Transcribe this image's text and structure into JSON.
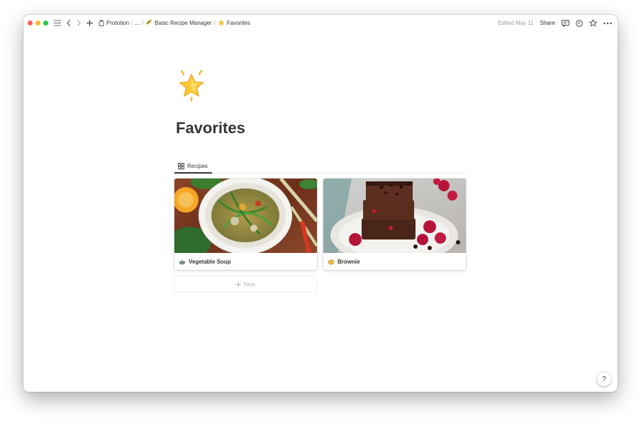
{
  "topbar": {
    "breadcrumbs": [
      {
        "label": "Prototion",
        "icon": "page-icon"
      },
      {
        "label": "...",
        "icon": ""
      },
      {
        "label": "Basic Recipe Manager",
        "icon": "taco-emoji"
      },
      {
        "label": "Favorites",
        "icon": "star-emoji"
      }
    ],
    "separator": "/",
    "edited": "Edited May 11",
    "share_label": "Share"
  },
  "page": {
    "icon": "glowing-star-emoji",
    "title": "Favorites"
  },
  "view_tab": {
    "label": "Recipes",
    "icon": "gallery-icon"
  },
  "cards": [
    {
      "title": "Vegetable Soup",
      "icon": "bowl-emoji"
    },
    {
      "title": "Brownie",
      "icon": "cookie-emoji"
    }
  ],
  "new_label": "New",
  "help_label": "?",
  "colors": {
    "accent_text": "#37352f",
    "muted": "#9b9a97"
  }
}
